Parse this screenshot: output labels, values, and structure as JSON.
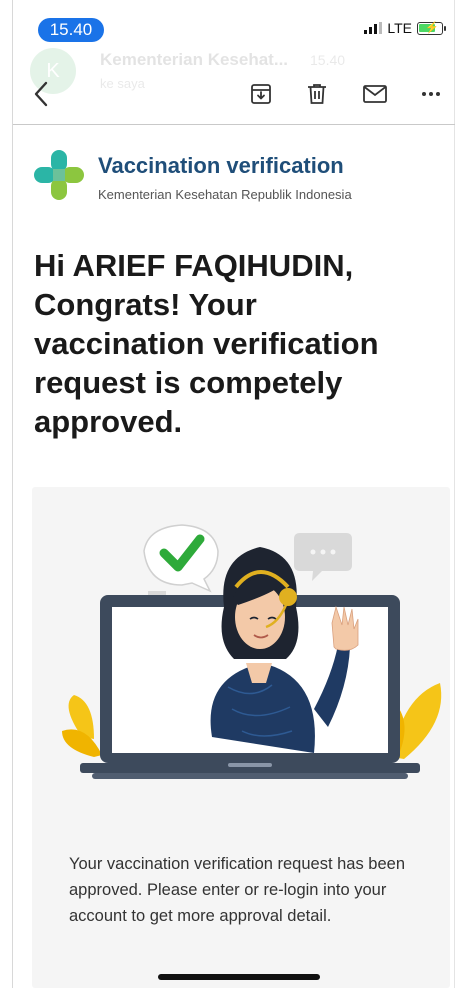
{
  "status_bar": {
    "time": "15.40",
    "network": "LTE"
  },
  "mail_header": {
    "avatar_initial": "K",
    "sender": "Kementerian Kesehat...",
    "time": "15.40",
    "recipient": "ke saya"
  },
  "toolbar": {
    "back_icon": "chevron-left-icon",
    "archive_icon": "archive-icon",
    "delete_icon": "trash-icon",
    "mark_unread_icon": "mail-icon",
    "more_icon": "more-icon"
  },
  "email": {
    "brand_title": "Vaccination verification",
    "brand_subtitle": "Kementerian Kesehatan Republik Indonesia",
    "headline": "Hi ARIEF FAQIHUDIN, Congrats! Your vaccination verification request is competely approved.",
    "body": "Your vaccination verification request has been approved. Please enter or re-login into your account to get more approval detail."
  },
  "colors": {
    "time_pill": "#1a73e8",
    "brand_blue": "#1f4e79",
    "logo_teal": "#2bb5a6",
    "logo_green": "#8cc63f",
    "check_green": "#2eaa3a",
    "shirt_navy": "#1f3a63",
    "leaf_yellow": "#f5c518"
  }
}
